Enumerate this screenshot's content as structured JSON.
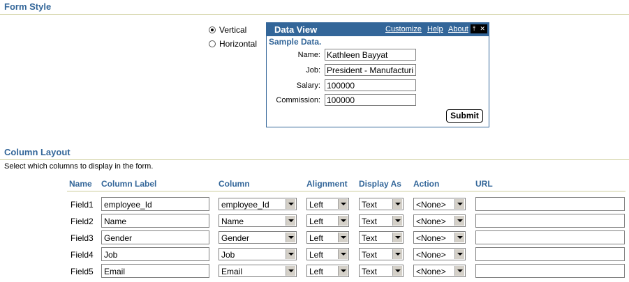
{
  "form_style": {
    "title": "Form Style",
    "options": [
      {
        "label": "Vertical",
        "checked": true
      },
      {
        "label": "Horizontal",
        "checked": false
      }
    ]
  },
  "data_view": {
    "title": "Data View",
    "links": [
      "Customize",
      "Help",
      "About"
    ],
    "sample_label": "Sample Data.",
    "fields": [
      {
        "label": "Name:",
        "value": "Kathleen Bayyat"
      },
      {
        "label": "Job:",
        "value": "President - Manufacturi"
      },
      {
        "label": "Salary:",
        "value": "100000"
      },
      {
        "label": "Commission:",
        "value": "100000"
      }
    ],
    "submit_label": "Submit"
  },
  "column_layout": {
    "title": "Column Layout",
    "instructions": "Select which columns to display in the form.",
    "headers": [
      "Name",
      "Column Label",
      "Column",
      "Alignment",
      "Display As",
      "Action",
      "URL"
    ],
    "rows": [
      {
        "name": "Field1",
        "label": "employee_Id",
        "column": "employee_Id",
        "alignment": "Left",
        "display": "Text",
        "action": "<None>",
        "url": ""
      },
      {
        "name": "Field2",
        "label": "Name",
        "column": "Name",
        "alignment": "Left",
        "display": "Text",
        "action": "<None>",
        "url": ""
      },
      {
        "name": "Field3",
        "label": "Gender",
        "column": "Gender",
        "alignment": "Left",
        "display": "Text",
        "action": "<None>",
        "url": ""
      },
      {
        "name": "Field4",
        "label": "Job",
        "column": "Job",
        "alignment": "Left",
        "display": "Text",
        "action": "<None>",
        "url": ""
      },
      {
        "name": "Field5",
        "label": "Email",
        "column": "Email",
        "alignment": "Left",
        "display": "Text",
        "action": "<None>",
        "url": ""
      }
    ]
  },
  "colors": {
    "accent": "#336699",
    "rule": "#cccc99"
  }
}
